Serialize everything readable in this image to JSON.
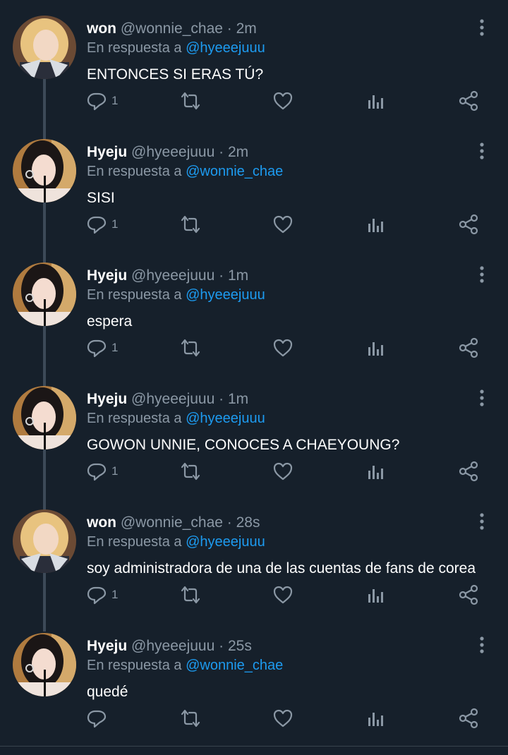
{
  "tweets": [
    {
      "display_name": "won",
      "handle": "@wonnie_chae",
      "separator": "·",
      "time": "2m",
      "reply_prefix": "En respuesta a",
      "reply_to": "@hyeeejuuu",
      "text": "ENTONCES SI ERAS TÚ?",
      "reply_count": "1",
      "avatar": "blonde-avatar"
    },
    {
      "display_name": "Hyeju",
      "handle": "@hyeeejuuu",
      "separator": "·",
      "time": "2m",
      "reply_prefix": "En respuesta a",
      "reply_to": "@wonnie_chae",
      "text": "SISI",
      "reply_count": "1",
      "avatar": "dark-hair-avatar"
    },
    {
      "display_name": "Hyeju",
      "handle": "@hyeeejuuu",
      "separator": "·",
      "time": "1m",
      "reply_prefix": "En respuesta a",
      "reply_to": "@hyeeejuuu",
      "text": "espera",
      "reply_count": "1",
      "avatar": "dark-hair-avatar"
    },
    {
      "display_name": "Hyeju",
      "handle": "@hyeeejuuu",
      "separator": "·",
      "time": "1m",
      "reply_prefix": "En respuesta a",
      "reply_to": "@hyeeejuuu",
      "text": "GOWON UNNIE, CONOCES A CHAEYOUNG?",
      "reply_count": "1",
      "avatar": "dark-hair-avatar"
    },
    {
      "display_name": "won",
      "handle": "@wonnie_chae",
      "separator": "·",
      "time": "28s",
      "reply_prefix": "En respuesta a",
      "reply_to": "@hyeeejuuu",
      "text": "soy administradora de una de las cuentas de fans de corea",
      "reply_count": "1",
      "avatar": "blonde-avatar"
    },
    {
      "display_name": "Hyeju",
      "handle": "@hyeeejuuu",
      "separator": "·",
      "time": "25s",
      "reply_prefix": "En respuesta a",
      "reply_to": "@wonnie_chae",
      "text": "quedé",
      "reply_count": "",
      "avatar": "dark-hair-avatar"
    }
  ],
  "icons": {
    "reply": "reply-icon",
    "retweet": "retweet-icon",
    "like": "heart-icon",
    "stats": "analytics-icon",
    "share": "share-icon",
    "more": "more-vertical-icon"
  },
  "colors": {
    "background": "#16202b",
    "text": "#ffffff",
    "secondary": "#8b98a5",
    "link": "#1d9bf0",
    "thread_line": "#3d4a58"
  }
}
